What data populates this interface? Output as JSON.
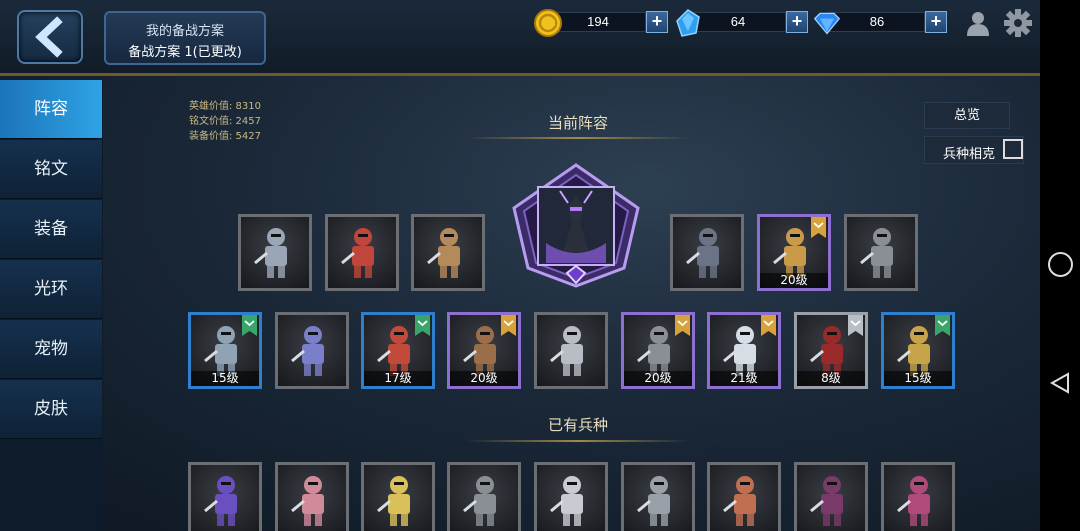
{
  "header": {
    "plan_title": "我的备战方案",
    "plan_name": "备战方案 1(已更改)"
  },
  "resources": {
    "gold": "194",
    "crystal": "64",
    "diamond": "86",
    "plus": "+"
  },
  "sidebar": {
    "items": [
      {
        "label": "阵容",
        "active": true
      },
      {
        "label": "铭文",
        "active": false
      },
      {
        "label": "装备",
        "active": false
      },
      {
        "label": "光环",
        "active": false
      },
      {
        "label": "宠物",
        "active": false
      },
      {
        "label": "皮肤",
        "active": false
      }
    ]
  },
  "stats": {
    "hero_value": "英雄价值: 8310",
    "inscription_value": "铭文价值: 2457",
    "equipment_value": "装备价值: 5427"
  },
  "sections": {
    "current": "当前阵容",
    "owned": "已有兵种"
  },
  "buttons": {
    "overview": "总览",
    "restraint": "兵种相克"
  },
  "lineup": {
    "row1": [
      {
        "level": "",
        "frame": "grey",
        "color": "#9aa6b6",
        "rank": ""
      },
      {
        "level": "",
        "frame": "grey",
        "color": "#c0453a",
        "rank": ""
      },
      {
        "level": "",
        "frame": "grey",
        "color": "#b58a5a",
        "rank": ""
      },
      {
        "level": "",
        "frame": "grey",
        "color": "#6b7486",
        "rank": ""
      },
      {
        "level": "20级",
        "frame": "purple",
        "color": "#c99a4a",
        "rank": "gold"
      },
      {
        "level": "",
        "frame": "grey",
        "color": "#8a8f96",
        "rank": ""
      }
    ],
    "row2": [
      {
        "level": "15级",
        "frame": "blue",
        "color": "#8fa3b5",
        "rank": "green"
      },
      {
        "level": "",
        "frame": "grey",
        "color": "#7a7fc9",
        "rank": ""
      },
      {
        "level": "17级",
        "frame": "blue",
        "color": "#c24a3a",
        "rank": "green"
      },
      {
        "level": "20级",
        "frame": "purple",
        "color": "#9a6e4a",
        "rank": "gold"
      },
      {
        "level": "",
        "frame": "grey",
        "color": "#b8bcc4",
        "rank": ""
      },
      {
        "level": "20级",
        "frame": "purple",
        "color": "#8a8e96",
        "rank": "gold"
      },
      {
        "level": "21级",
        "frame": "purple",
        "color": "#d6dde4",
        "rank": "gold"
      },
      {
        "level": "8级",
        "frame": "silver",
        "color": "#9a2a2a",
        "rank": "silver"
      },
      {
        "level": "15级",
        "frame": "blue",
        "color": "#c7a44a",
        "rank": "green"
      }
    ],
    "row3": [
      {
        "level": "",
        "frame": "grey",
        "color": "#6a4fc0",
        "rank": ""
      },
      {
        "level": "",
        "frame": "grey",
        "color": "#d08a9a",
        "rank": ""
      },
      {
        "level": "",
        "frame": "grey",
        "color": "#d9c05a",
        "rank": ""
      },
      {
        "level": "",
        "frame": "grey",
        "color": "#8a8f96",
        "rank": ""
      },
      {
        "level": "",
        "frame": "grey",
        "color": "#c8ccd2",
        "rank": ""
      },
      {
        "level": "",
        "frame": "grey",
        "color": "#9aa0a8",
        "rank": ""
      },
      {
        "level": "",
        "frame": "grey",
        "color": "#c07050",
        "rank": ""
      },
      {
        "level": "",
        "frame": "grey",
        "color": "#7a3a6a",
        "rank": ""
      },
      {
        "level": "",
        "frame": "grey",
        "color": "#b04a7a",
        "rank": ""
      }
    ]
  }
}
